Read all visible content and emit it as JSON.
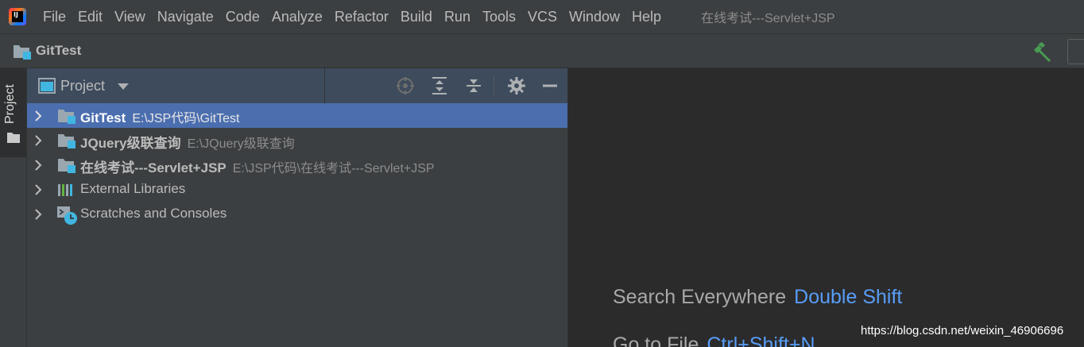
{
  "menubar": {
    "logo_text": "IJ",
    "items": [
      "File",
      "Edit",
      "View",
      "Navigate",
      "Code",
      "Analyze",
      "Refactor",
      "Build",
      "Run",
      "Tools",
      "VCS",
      "Window",
      "Help"
    ],
    "window_title": "在线考试---Servlet+JSP"
  },
  "navbar": {
    "project_name": "GitTest"
  },
  "stripe": {
    "project_tab": "Project"
  },
  "panel": {
    "title": "Project",
    "tree": [
      {
        "name": "GitTest",
        "path": "E:\\JSP代码\\GitTest",
        "selected": true,
        "icon": "module-folder-icon"
      },
      {
        "name": "JQuery级联查询",
        "path": "E:\\JQuery级联查询",
        "selected": false,
        "icon": "module-folder-icon"
      },
      {
        "name": "在线考试---Servlet+JSP",
        "path": "E:\\JSP代码\\在线考试---Servlet+JSP",
        "selected": false,
        "icon": "module-folder-icon"
      },
      {
        "name": "External Libraries",
        "path": "",
        "selected": false,
        "icon": "libraries-icon"
      },
      {
        "name": "Scratches and Consoles",
        "path": "",
        "selected": false,
        "icon": "scratches-icon"
      }
    ]
  },
  "editor": {
    "hints": [
      {
        "label": "Search Everywhere",
        "key": "Double Shift"
      },
      {
        "label": "Go to File",
        "key": "Ctrl+Shift+N"
      }
    ]
  },
  "watermark": "https://blog.csdn.net/weixin_46906696",
  "colors": {
    "selection": "#4b6eaf",
    "hint_key": "#589df6",
    "hammer": "#499c54"
  }
}
